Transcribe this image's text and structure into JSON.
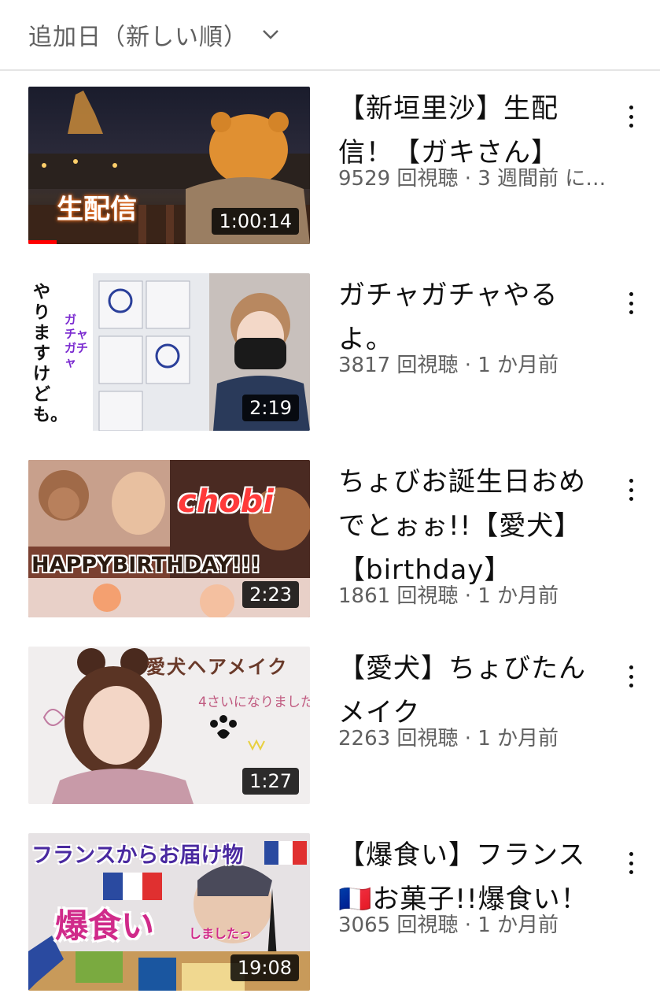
{
  "sort": {
    "label": "追加日（新しい順）",
    "icon": "chevron-down-icon"
  },
  "videos": [
    {
      "title": "【新垣里沙】生配信！【ガキさん】",
      "meta": "9529 回視聴 · 3 週間前 に…",
      "duration": "1:00:14",
      "thumb_text": "生配信",
      "watched_fraction": 0.1
    },
    {
      "title": "ガチャガチャやるよ。",
      "meta": "3817 回視聴 · 1 か月前",
      "duration": "2:19",
      "thumb_text": "やりますけども。",
      "thumb_text2": "ガチャガチャ"
    },
    {
      "title": "ちょびお誕生日おめでとぉぉ!!【愛犬】【birthday】",
      "meta": "1861 回視聴 · 1 か月前",
      "duration": "2:23",
      "thumb_text": "HAPPYBIRTHDAY!!!",
      "thumb_text2": "chobi"
    },
    {
      "title": "【愛犬】ちょびたんメイク",
      "meta": "2263 回視聴 · 1 か月前",
      "duration": "1:27",
      "thumb_text": "愛犬ヘアメイク",
      "thumb_text2": "4さいになりました。"
    },
    {
      "title": "【爆食い】フランス🇫🇷お菓子!!爆食い！",
      "meta": "3065 回視聴 · 1 か月前",
      "duration": "19:08",
      "thumb_text": "フランスからお届け物",
      "thumb_text2": "爆食い",
      "thumb_text3": "しましたっ"
    }
  ]
}
